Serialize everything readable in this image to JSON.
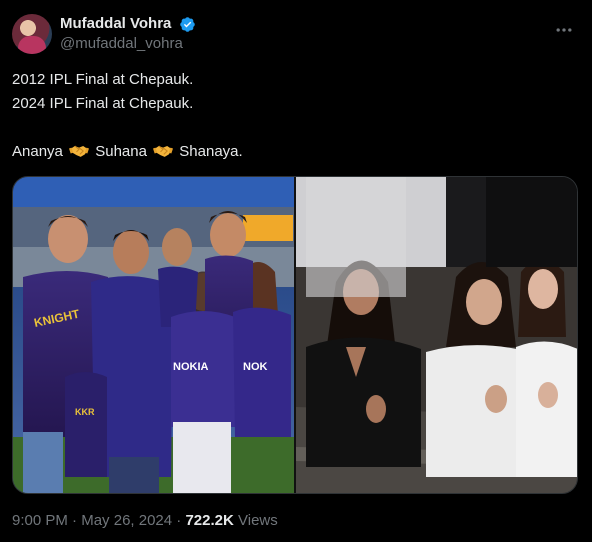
{
  "author": {
    "display_name": "Mufaddal Vohra",
    "handle": "@mufaddal_vohra",
    "verified_color": "#1d9bf0"
  },
  "tweet": {
    "lines": [
      "2012 IPL Final at Chepauk.",
      "2024 IPL Final at Chepauk."
    ],
    "names_line": {
      "name1": "Ananya",
      "name2": "Suhana",
      "name3": "Shanaya."
    },
    "separator_icon": "handshake-emoji"
  },
  "media": {
    "left_photo_text": {
      "jersey_logo": "NOKIA",
      "jersey_logo_2": "NOK"
    }
  },
  "meta": {
    "time": "9:00 PM",
    "dot1": "·",
    "date": "May 26, 2024",
    "dot2": "·",
    "views_count": "722.2K",
    "views_label": "Views"
  },
  "icons": {
    "more": "more-dots-icon",
    "verified": "verified-badge-icon"
  },
  "colors": {
    "background": "#000000",
    "text": "#e7e9ea",
    "muted": "#71767b",
    "border": "#2f3336",
    "accent": "#1d9bf0"
  }
}
